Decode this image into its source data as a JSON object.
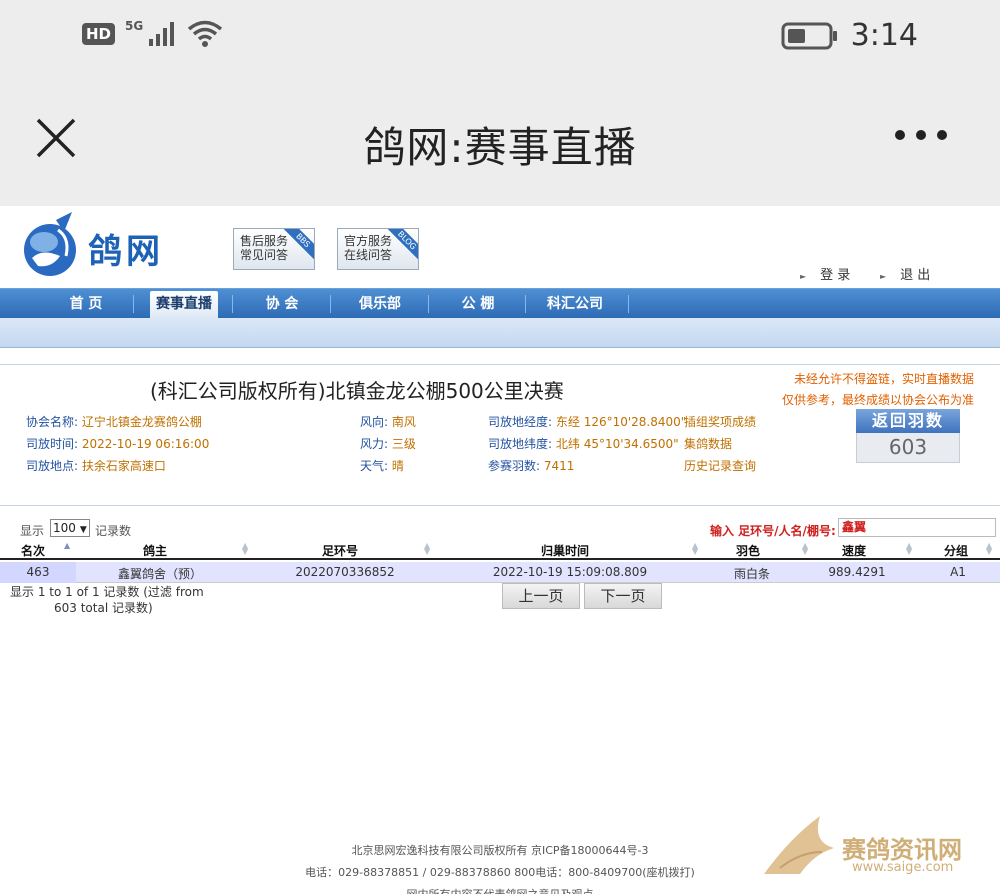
{
  "status_bar": {
    "hd_label": "HD",
    "network_label": "5G",
    "time": "3:14"
  },
  "nav": {
    "title": "鸽网:赛事直播"
  },
  "site": {
    "logo_text": "鸽网",
    "service_buttons": [
      {
        "line1": "售后服务",
        "line2": "常见问答",
        "tag": "BBS"
      },
      {
        "line1": "官方服务",
        "line2": "在线问答",
        "tag": "BLOG"
      }
    ],
    "login_label": "登 录",
    "logout_label": "退 出"
  },
  "menu": {
    "items": [
      "首 页",
      "赛事直播",
      "协 会",
      "俱乐部",
      "公 棚",
      "科汇公司"
    ],
    "active_index": 1
  },
  "race": {
    "title": "(科汇公司版权所有)北镇金龙公棚500公里决赛",
    "association_label": "协会名称:",
    "association_value": "辽宁北镇金龙赛鸽公棚",
    "release_time_label": "司放时间:",
    "release_time_value": "2022-10-19 06:16:00",
    "release_place_label": "司放地点:",
    "release_place_value": "扶余石家高速口",
    "wind_dir_label": "风向:",
    "wind_dir_value": "南风",
    "wind_force_label": "风力:",
    "wind_force_value": "三级",
    "weather_label": "天气:",
    "weather_value": "晴",
    "longitude_label": "司放地经度:",
    "longitude_value": "东经 126°10'28.8400\"",
    "latitude_label": "司放地纬度:",
    "latitude_value": "北纬 45°10'34.6500\"",
    "entries_label": "参赛羽数:",
    "entries_value": "7411",
    "link_prize": "插组奖项成绩",
    "link_group": "集鸽数据",
    "link_history": "历史记录查询",
    "notice_line1": "未经允许不得盗链，实时直播数据",
    "notice_line2": "仅供参考，最终成绩以协会公布为准",
    "return_label": "返回羽数",
    "return_count": "603"
  },
  "table": {
    "show_label": "显示",
    "page_length": "100",
    "records_label": "记录数",
    "search_label": "输入 足环号/人名/棚号:",
    "search_value": "鑫翼",
    "columns": [
      "名次",
      "鸽主",
      "足环号",
      "归巢时间",
      "羽色",
      "速度",
      "分组"
    ],
    "rows": [
      {
        "rank": "463",
        "owner": "鑫翼鸽舍（预）",
        "ring": "2022070336852",
        "time": "2022-10-19 15:09:08.809",
        "color": "雨白条",
        "speed": "989.4291",
        "group": "A1"
      }
    ],
    "info_line1": "显示 1 to 1 of 1 记录数 (过滤 from",
    "info_line2": "603 total 记录数)",
    "prev_label": "上一页",
    "next_label": "下一页"
  },
  "footer": {
    "line1": "北京思网宏逸科技有限公司版权所有 京ICP备18000644号-3",
    "line2": "电话：029-88378851 / 029-88378860   800电话：800-8409700(座机拨打)",
    "line3": "网内所有内容不代表鸽网之意见及观点"
  },
  "watermark": {
    "text": "赛鸽资讯网",
    "url": "www.saige.com"
  }
}
